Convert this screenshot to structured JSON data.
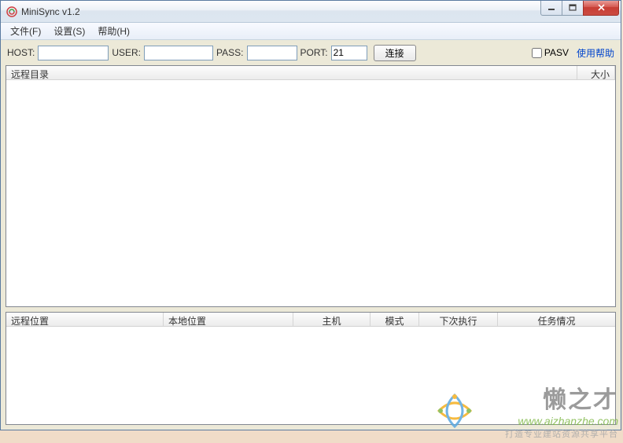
{
  "window": {
    "title": "MiniSync v1.2"
  },
  "menu": {
    "file": "文件(F)",
    "settings": "设置(S)",
    "help": "帮助(H)"
  },
  "toolbar": {
    "host_label": "HOST:",
    "user_label": "USER:",
    "pass_label": "PASS:",
    "port_label": "PORT:",
    "port_value": "21",
    "connect_label": "连接",
    "pasv_label": "PASV",
    "help_link": "使用帮助"
  },
  "top_list": {
    "col_remote_dir": "远程目录",
    "col_size": "大小"
  },
  "bottom_list": {
    "col_remote_path": "远程位置",
    "col_local_path": "本地位置",
    "col_host": "主机",
    "col_mode": "模式",
    "col_next_run": "下次执行",
    "col_status": "任务情况"
  },
  "watermark": {
    "title": "懒之才",
    "url": "www.aizhanzhe.com",
    "subtitle": "打造专业建站资源共享平台"
  }
}
